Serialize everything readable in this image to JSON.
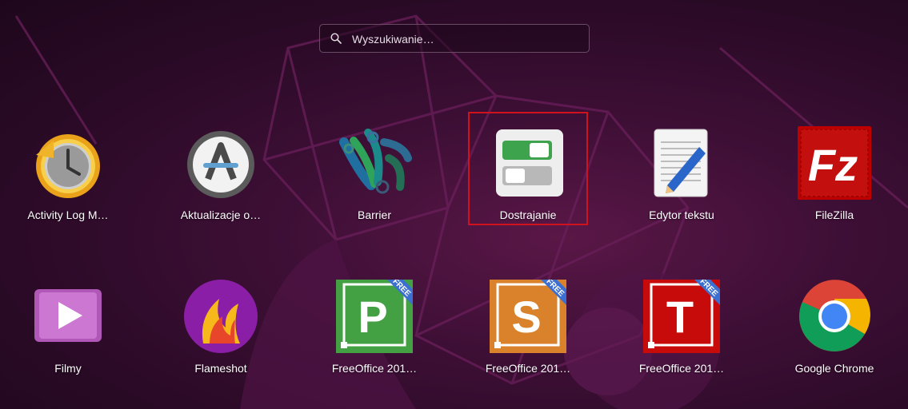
{
  "search": {
    "placeholder": "Wyszukiwanie…",
    "value": "",
    "icon": "search-icon"
  },
  "apps": [
    {
      "label": "Activity Log M…",
      "icon": "activity-log-clock-icon"
    },
    {
      "label": "Aktualizacje o…",
      "icon": "software-updater-icon"
    },
    {
      "label": "Barrier",
      "icon": "barrier-icon"
    },
    {
      "label": "Dostrajanie",
      "icon": "tweaks-toggle-icon",
      "selected": true
    },
    {
      "label": "Edytor tekstu",
      "icon": "text-editor-icon"
    },
    {
      "label": "FileZilla",
      "icon": "filezilla-icon"
    },
    {
      "label": "Filmy",
      "icon": "videos-play-icon"
    },
    {
      "label": "Flameshot",
      "icon": "flameshot-icon"
    },
    {
      "label": "FreeOffice 201…",
      "icon": "freeoffice-presentations-icon",
      "letter": "P",
      "badge": "FREE"
    },
    {
      "label": "FreeOffice 201…",
      "icon": "freeoffice-planmaker-icon",
      "letter": "S",
      "badge": "FREE"
    },
    {
      "label": "FreeOffice 201…",
      "icon": "freeoffice-textmaker-icon",
      "letter": "T",
      "badge": "FREE"
    },
    {
      "label": "Google Chrome",
      "icon": "chrome-icon"
    }
  ],
  "colors": {
    "selection_outline": "#d0121e",
    "background": "#3e0f36"
  }
}
